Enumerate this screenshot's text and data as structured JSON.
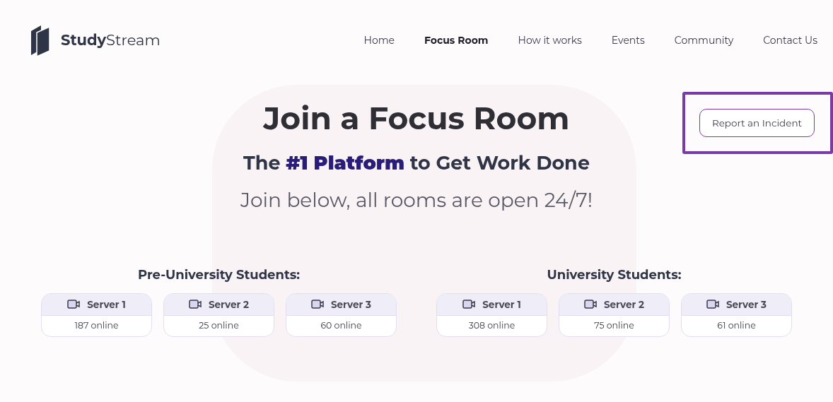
{
  "brand": {
    "name": "**Study**Stream"
  },
  "nav": [
    {
      "label": "Home",
      "selected": false
    },
    {
      "label": "Focus Room",
      "selected": true
    },
    {
      "label": "How it works",
      "selected": false
    },
    {
      "label": "Events",
      "selected": false
    },
    {
      "label": "Community",
      "selected": false
    },
    {
      "label": "Contact Us",
      "selected": false
    }
  ],
  "report_button": {
    "label": "Report an Incident",
    "highlighted": true
  },
  "hero": {
    "title": "Join a Focus Room",
    "subtitle": "The **#1 Platform** to Get Work Done",
    "tagline": "Join below, all rooms are open 24/7!"
  },
  "groups": [
    {
      "title": "Pre-University Students:",
      "servers": [
        {
          "name": "Server 1",
          "online": "187 online"
        },
        {
          "name": "Server 2",
          "online": "25 online"
        },
        {
          "name": "Server 3",
          "online": "60 online"
        }
      ]
    },
    {
      "title": "University Students:",
      "servers": [
        {
          "name": "Server 1",
          "online": "308 online"
        },
        {
          "name": "Server 2",
          "online": "75 online"
        },
        {
          "name": "Server 3",
          "online": "61 online"
        }
      ]
    }
  ]
}
